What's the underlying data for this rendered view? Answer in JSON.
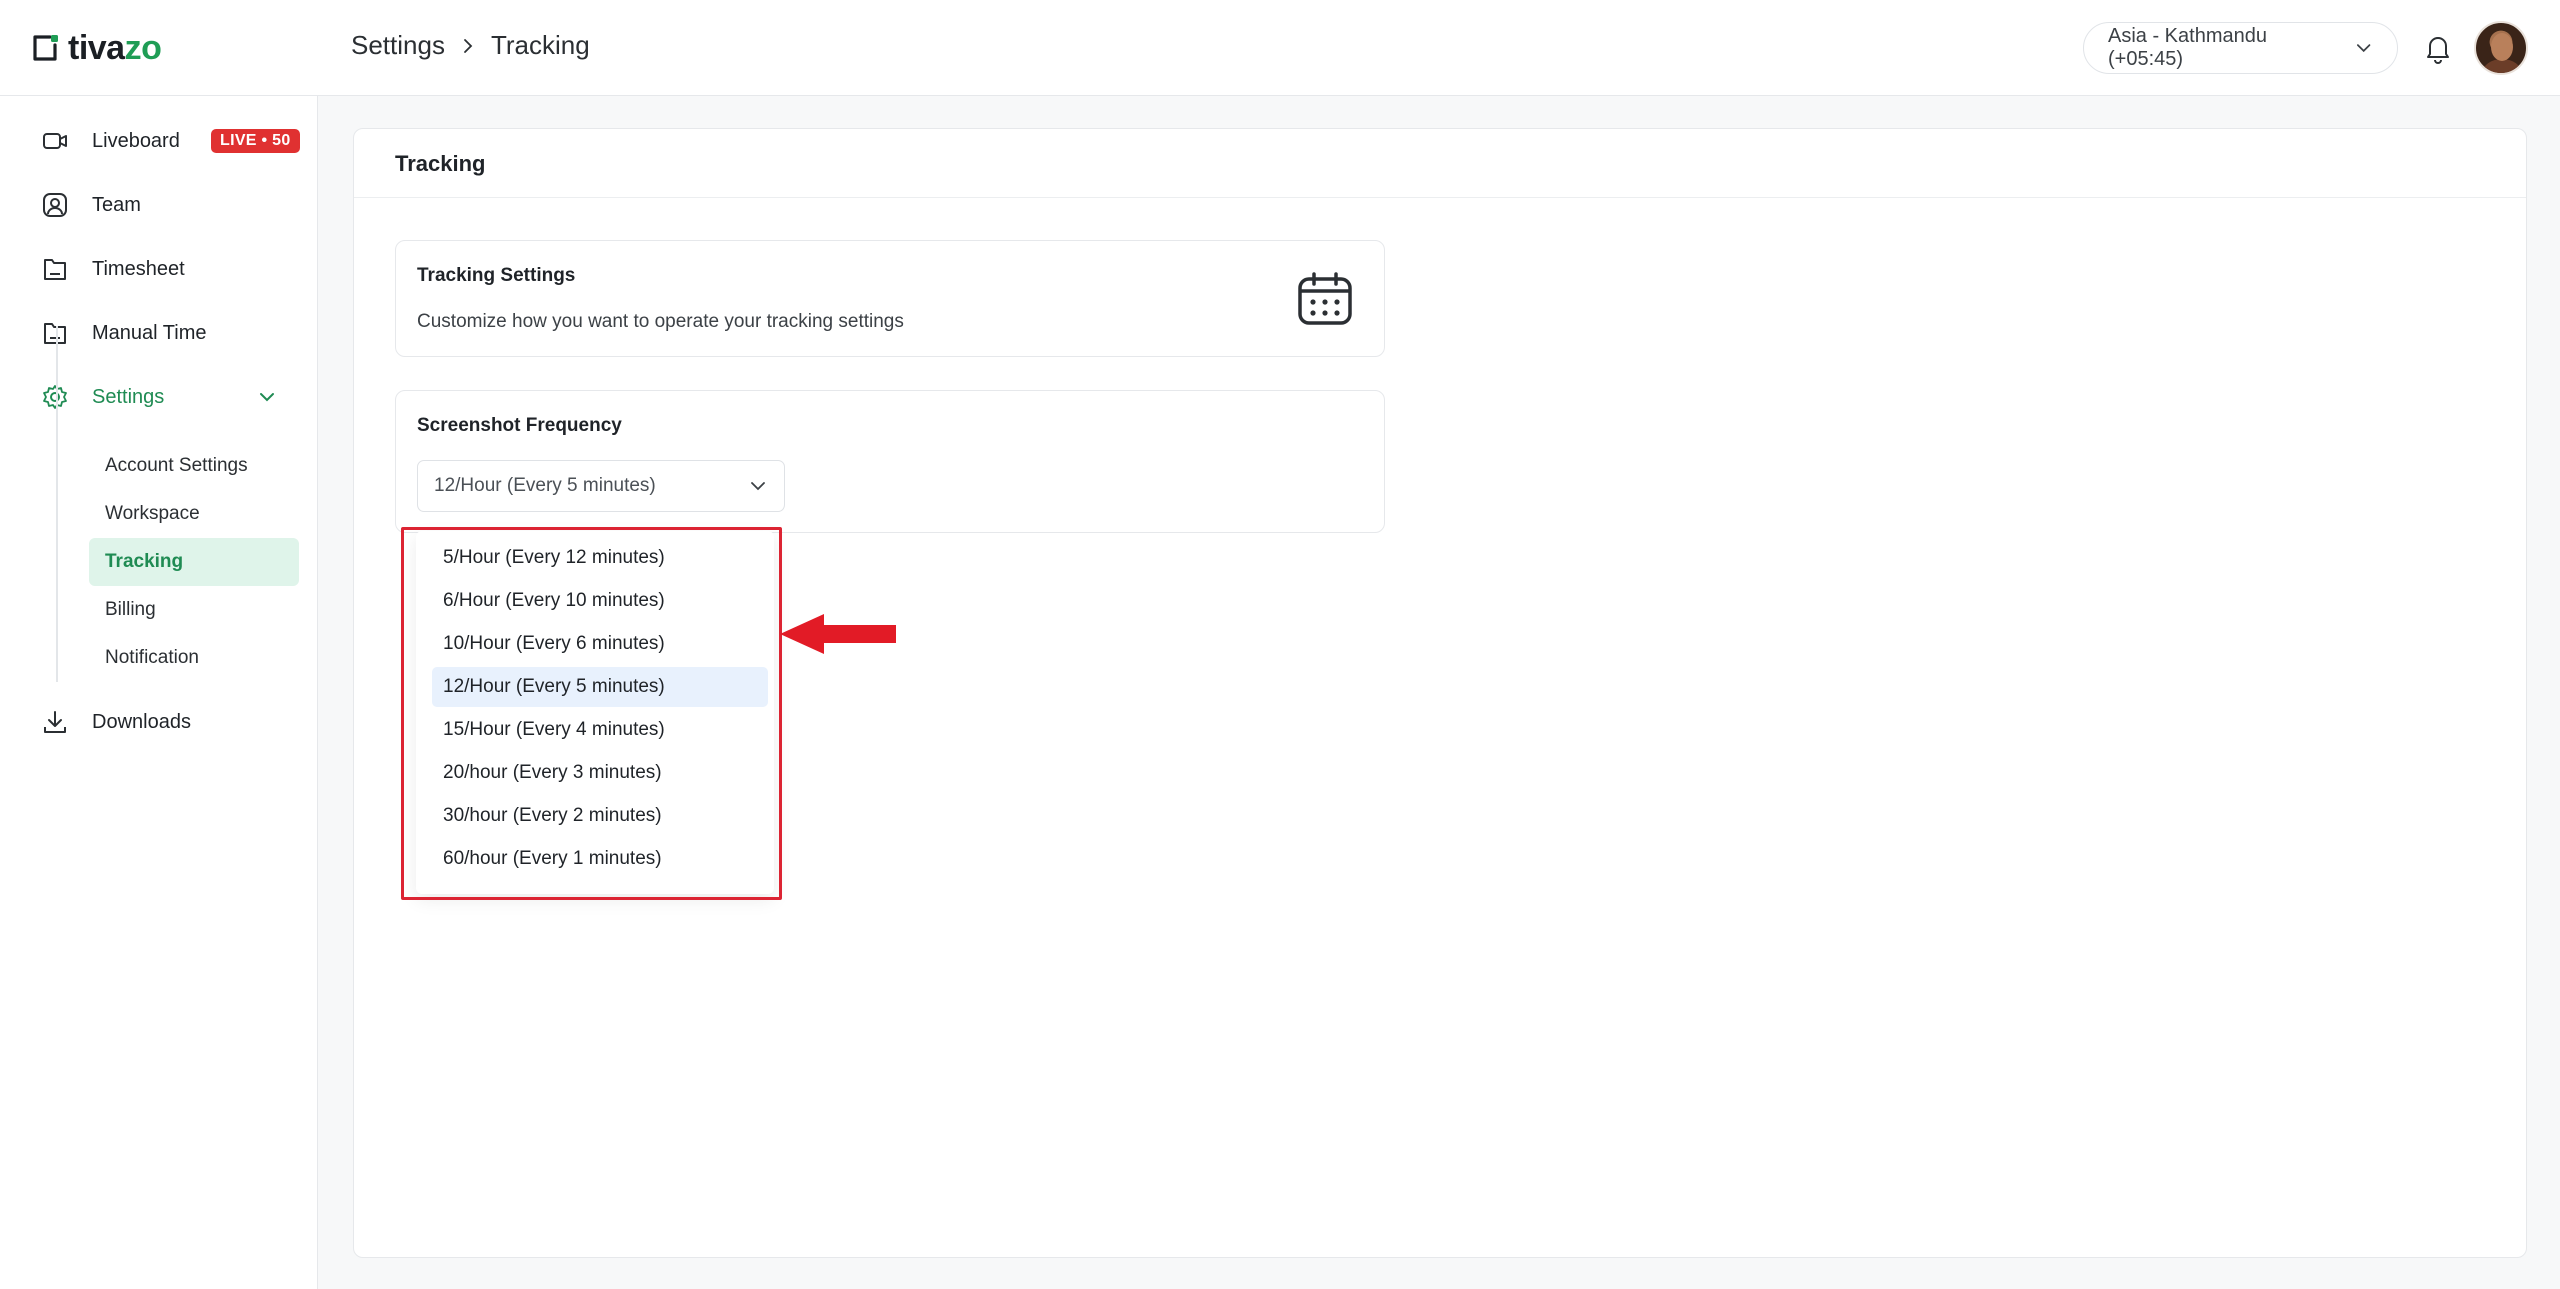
{
  "app": {
    "logo_text": "tivazo",
    "brand_color": "#1f9d55"
  },
  "header": {
    "breadcrumb": [
      "Settings",
      "Tracking"
    ],
    "timezone": "Asia - Kathmandu (+05:45)",
    "bell_icon": "bell-icon",
    "avatar_icon": "user-avatar"
  },
  "sidebar": {
    "items": [
      {
        "label": "Liveboard",
        "icon": "camera-icon",
        "badge": "LIVE • 50"
      },
      {
        "label": "Team",
        "icon": "user-square-icon"
      },
      {
        "label": "Timesheet",
        "icon": "folder-icon"
      },
      {
        "label": "Manual Time",
        "icon": "folder-icon"
      },
      {
        "label": "Settings",
        "icon": "gear-icon"
      },
      {
        "label": "Downloads",
        "icon": "download-icon"
      }
    ],
    "settings_sub": [
      "Account Settings",
      "Workspace",
      "Tracking",
      "Billing",
      "Notification"
    ],
    "active_sub": "Tracking",
    "live_badge_color": "#e03131",
    "active_color": "#1f8b53"
  },
  "main": {
    "title": "Tracking",
    "tracking_card": {
      "title": "Tracking Settings",
      "description": "Customize how you want to operate your tracking settings",
      "icon": "calendar-icon"
    },
    "frequency_card": {
      "title": "Screenshot Frequency",
      "selected": "12/Hour (Every 5 minutes)",
      "options": [
        "5/Hour (Every 12 minutes)",
        "6/Hour (Every 10 minutes)",
        "10/Hour (Every 6 minutes)",
        "12/Hour (Every 5 minutes)",
        "15/Hour (Every 4 minutes)",
        "20/hour (Every 3 minutes)",
        "30/hour (Every 2 minutes)",
        "60/hour (Every 1 minutes)"
      ],
      "selected_index": 3
    },
    "annotation": {
      "box_color": "#dc2433",
      "arrow_color": "#e21b26"
    }
  }
}
